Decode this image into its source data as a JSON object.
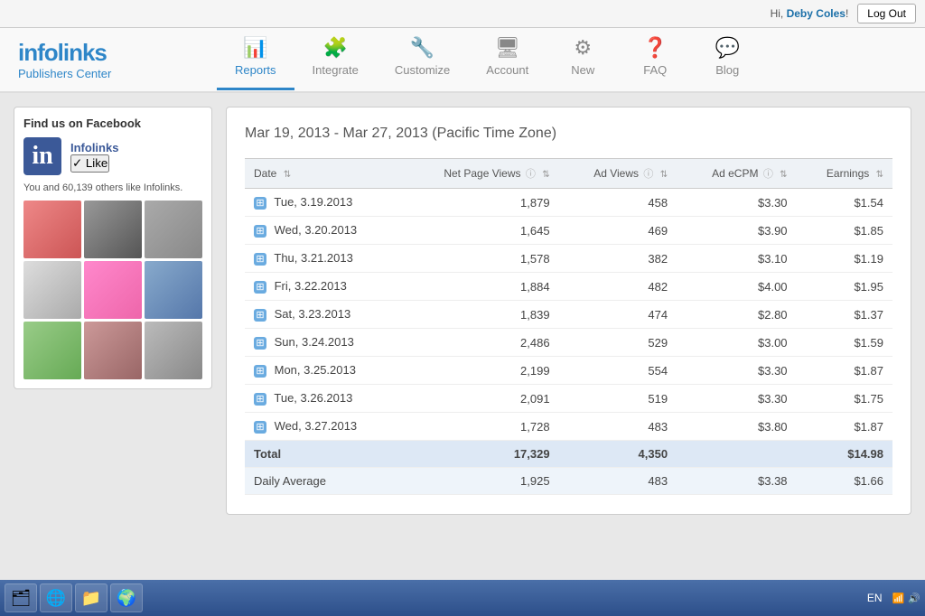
{
  "greeting": {
    "text": "Hi, Deby Coles!",
    "name": "Deby Coles",
    "logout_label": "Log Out"
  },
  "logo": {
    "name": "infolinks",
    "sub": "Publishers Center"
  },
  "nav": {
    "items": [
      {
        "id": "reports",
        "label": "Reports",
        "icon": "📊",
        "active": true
      },
      {
        "id": "integrate",
        "label": "Integrate",
        "icon": "🧩",
        "active": false
      },
      {
        "id": "customize",
        "label": "Customize",
        "icon": "🔧",
        "active": false
      },
      {
        "id": "account",
        "label": "Account",
        "icon": "🖥",
        "active": false
      },
      {
        "id": "new",
        "label": "New",
        "icon": "⚙",
        "active": false
      },
      {
        "id": "faq",
        "label": "FAQ",
        "icon": "❓",
        "active": false
      },
      {
        "id": "blog",
        "label": "Blog",
        "icon": "💬",
        "active": false
      }
    ]
  },
  "sidebar": {
    "fb_widget": {
      "title": "Find us on Facebook",
      "page_name": "Infolinks",
      "like_button": "Like",
      "like_count": "You and 60,139 others like Infolinks."
    }
  },
  "report": {
    "date_range": "Mar 19, 2013 - Mar 27, 2013",
    "timezone": "(Pacific Time Zone)",
    "columns": [
      {
        "id": "date",
        "label": "Date",
        "sortable": true
      },
      {
        "id": "net_page_views",
        "label": "Net Page Views",
        "info": true,
        "sortable": true,
        "align": "right"
      },
      {
        "id": "ad_views",
        "label": "Ad Views",
        "info": true,
        "sortable": true,
        "align": "right"
      },
      {
        "id": "ad_ecpm",
        "label": "Ad eCPM",
        "info": true,
        "sortable": true,
        "align": "right"
      },
      {
        "id": "earnings",
        "label": "Earnings",
        "sortable": true,
        "align": "right"
      }
    ],
    "rows": [
      {
        "date": "Tue, 3.19.2013",
        "net_page_views": "1,879",
        "ad_views": "458",
        "ad_ecpm": "$3.30",
        "earnings": "$1.54"
      },
      {
        "date": "Wed, 3.20.2013",
        "net_page_views": "1,645",
        "ad_views": "469",
        "ad_ecpm": "$3.90",
        "earnings": "$1.85"
      },
      {
        "date": "Thu, 3.21.2013",
        "net_page_views": "1,578",
        "ad_views": "382",
        "ad_ecpm": "$3.10",
        "earnings": "$1.19"
      },
      {
        "date": "Fri, 3.22.2013",
        "net_page_views": "1,884",
        "ad_views": "482",
        "ad_ecpm": "$4.00",
        "earnings": "$1.95"
      },
      {
        "date": "Sat, 3.23.2013",
        "net_page_views": "1,839",
        "ad_views": "474",
        "ad_ecpm": "$2.80",
        "earnings": "$1.37"
      },
      {
        "date": "Sun, 3.24.2013",
        "net_page_views": "2,486",
        "ad_views": "529",
        "ad_ecpm": "$3.00",
        "earnings": "$1.59"
      },
      {
        "date": "Mon, 3.25.2013",
        "net_page_views": "2,199",
        "ad_views": "554",
        "ad_ecpm": "$3.30",
        "earnings": "$1.87"
      },
      {
        "date": "Tue, 3.26.2013",
        "net_page_views": "2,091",
        "ad_views": "519",
        "ad_ecpm": "$3.30",
        "earnings": "$1.75"
      },
      {
        "date": "Wed, 3.27.2013",
        "net_page_views": "1,728",
        "ad_views": "483",
        "ad_ecpm": "$3.80",
        "earnings": "$1.87"
      }
    ],
    "total": {
      "label": "Total",
      "net_page_views": "17,329",
      "ad_views": "4,350",
      "ad_ecpm": "",
      "earnings": "$14.98"
    },
    "daily_average": {
      "label": "Daily Average",
      "net_page_views": "1,925",
      "ad_views": "483",
      "ad_ecpm": "$3.38",
      "earnings": "$1.66"
    }
  },
  "taskbar": {
    "lang": "EN",
    "buttons": [
      "🗂",
      "🌐",
      "📁",
      "🌍"
    ]
  }
}
